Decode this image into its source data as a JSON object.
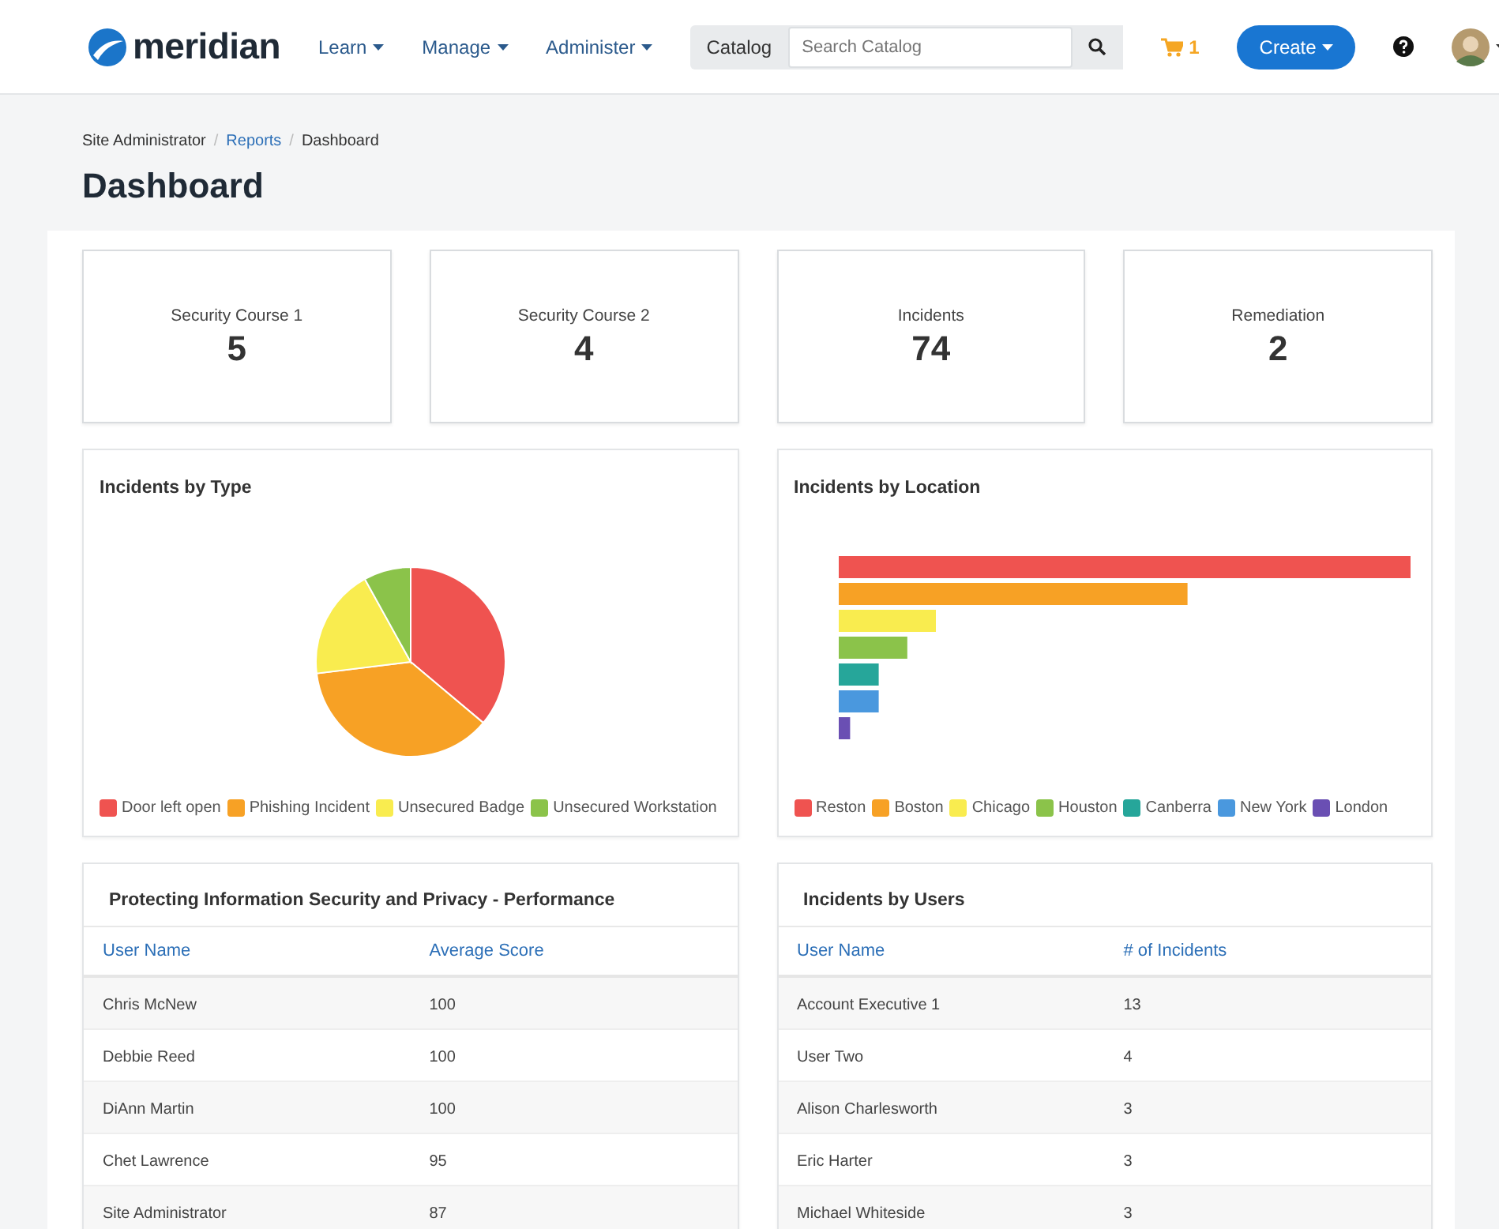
{
  "header": {
    "logo": "meridian",
    "nav": [
      {
        "label": "Learn"
      },
      {
        "label": "Manage"
      },
      {
        "label": "Administer"
      }
    ],
    "search": {
      "label": "Catalog",
      "placeholder": "Search Catalog"
    },
    "cart_count": "1",
    "create_button": "Create"
  },
  "breadcrumb": [
    {
      "label": "Site Administrator",
      "link": false
    },
    {
      "separator": "/",
      "label": "Reports",
      "link": true
    },
    {
      "separator": "/",
      "label": "Dashboard",
      "link": false
    }
  ],
  "title": "Dashboard",
  "stats": [
    {
      "label": "Security Course 1",
      "value": "5"
    },
    {
      "label": "Security Course 2",
      "value": "4"
    },
    {
      "label": "Incidents",
      "value": "74"
    },
    {
      "label": "Remediation",
      "value": "2"
    }
  ],
  "incidents_by_type": {
    "title": "Incidents by Type",
    "legend": [
      {
        "label": "Door left open",
        "color": "#ef5350"
      },
      {
        "label": "Phishing Incident",
        "color": "#f7a125"
      },
      {
        "label": "Unsecured Badge",
        "color": "#f9ec4f"
      },
      {
        "label": "Unsecured Workstation",
        "color": "#8bc34a"
      }
    ]
  },
  "incidents_by_location": {
    "title": "Incidents by Location",
    "legend": [
      {
        "label": "Reston",
        "color": "#ef5350"
      },
      {
        "label": "Boston",
        "color": "#f7a125"
      },
      {
        "label": "Chicago",
        "color": "#f9ec4f"
      },
      {
        "label": "Houston",
        "color": "#8bc34a"
      },
      {
        "label": "Canberra",
        "color": "#26a69a"
      },
      {
        "label": "New York",
        "color": "#4a98de"
      },
      {
        "label": "London",
        "color": "#6a4fb3"
      }
    ]
  },
  "tables": [
    {
      "title": "Protecting Information Security and Privacy - Performance",
      "columns": [
        "User Name",
        "Average Score"
      ],
      "rows": [
        [
          "Chris McNew",
          "100"
        ],
        [
          "Debbie Reed",
          "100"
        ],
        [
          "DiAnn Martin",
          "100"
        ],
        [
          "Chet Lawrence",
          "95"
        ],
        [
          "Site Administrator",
          "87"
        ]
      ]
    },
    {
      "title": "Incidents by Users",
      "columns": [
        "User Name",
        "# of Incidents"
      ],
      "rows": [
        [
          "Account Executive 1",
          "13"
        ],
        [
          "User Two",
          "4"
        ],
        [
          "Alison Charlesworth",
          "3"
        ],
        [
          "Eric Harter",
          "3"
        ],
        [
          "Michael Whiteside",
          "3"
        ]
      ]
    }
  ]
}
